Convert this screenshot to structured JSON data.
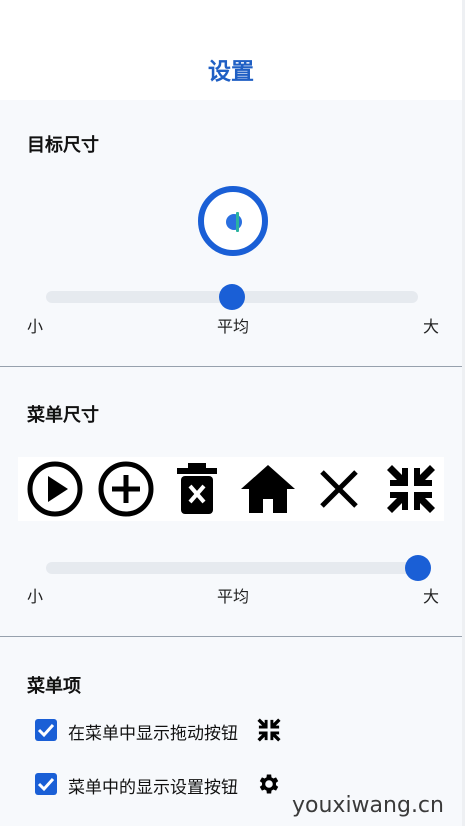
{
  "header": {
    "title": "设置"
  },
  "target_size": {
    "section_title": "目标尺寸",
    "slider": {
      "label_min": "小",
      "label_mid": "平均",
      "label_max": "大",
      "value": 0.5
    }
  },
  "menu_size": {
    "section_title": "菜单尺寸",
    "icons": [
      "play-circle-icon",
      "add-circle-icon",
      "delete-icon",
      "home-icon",
      "close-icon",
      "collapse-icon"
    ],
    "slider": {
      "label_min": "小",
      "label_mid": "平均",
      "label_max": "大",
      "value": 1.0
    }
  },
  "menu_items": {
    "section_title": "菜单项",
    "options": [
      {
        "label": "在菜单中显示拖动按钮",
        "checked": true,
        "icon": "collapse-icon"
      },
      {
        "label": "菜单中的显示设置按钮",
        "checked": true,
        "icon": "gear-icon"
      }
    ]
  },
  "watermark": {
    "text": "youxiwang.cn"
  },
  "colors": {
    "accent": "#1a5fd6",
    "title": "#1f5fc4",
    "background": "#f7f9fc"
  }
}
